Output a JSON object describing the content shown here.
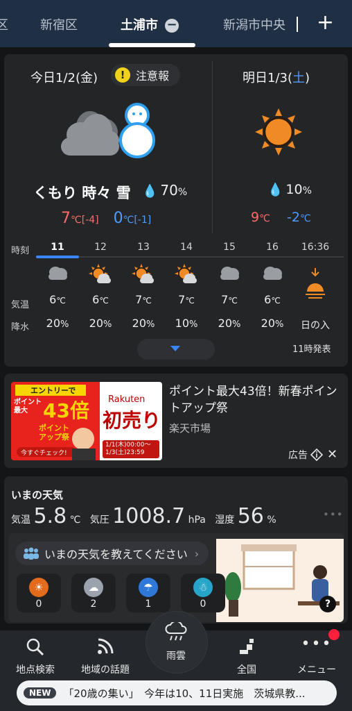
{
  "tabs": {
    "left_edge": "区",
    "items": [
      "新宿区",
      "土浦市",
      "新潟市中央"
    ],
    "active_index": 1,
    "add_label": "+"
  },
  "today": {
    "date_label": "今日1/2(金)",
    "warning_label": "注意報",
    "weather_text": "くもり 時々 雪",
    "pop": "70",
    "pop_unit": "%",
    "high": "7",
    "high_diff": "[-4]",
    "low": "0",
    "low_diff": "[-1]",
    "temp_unit": "℃"
  },
  "tomorrow": {
    "date_prefix": "明日1/3(",
    "date_day": "土",
    "date_suffix": ")",
    "pop": "10",
    "pop_unit": "%",
    "high": "9",
    "low": "-2",
    "temp_unit": "℃"
  },
  "hourly": {
    "labels": {
      "time": "時刻",
      "temp": "気温",
      "precip": "降水"
    },
    "hours": [
      {
        "time": "11",
        "icon": "cloud-icon",
        "temp": "6",
        "pop": "20"
      },
      {
        "time": "12",
        "icon": "sun-cloud-icon",
        "temp": "6",
        "pop": "20"
      },
      {
        "time": "13",
        "icon": "sun-cloud-icon",
        "temp": "7",
        "pop": "20"
      },
      {
        "time": "14",
        "icon": "sun-cloud-icon",
        "temp": "7",
        "pop": "10"
      },
      {
        "time": "15",
        "icon": "cloud-icon",
        "temp": "7",
        "pop": "20"
      },
      {
        "time": "16",
        "icon": "cloud-icon",
        "temp": "6",
        "pop": "20"
      }
    ],
    "sunset_time": "16:36",
    "sunset_label": "日の入",
    "temp_unit": "℃",
    "pop_unit": "%",
    "issued": "11時発表"
  },
  "ad": {
    "title": "ポイント最大43倍！新春ポイントアップ祭",
    "source": "楽天市場",
    "label": "広告",
    "image_text": {
      "entry": "エントリーで",
      "points": "ポイント最大",
      "multiplier": "43倍",
      "fest": "ポイントアップ祭",
      "check": "今すぐチェック!",
      "brand": "Rakuten",
      "sale": "初売り",
      "period": "1/1(木)00:00～1/3(土)23:59"
    }
  },
  "now": {
    "title": "いまの天気",
    "temp_label": "気温",
    "temp_value": "5.8",
    "temp_unit": "℃",
    "pressure_label": "気圧",
    "pressure_value": "1008.7",
    "pressure_unit": "hPa",
    "humidity_label": "湿度",
    "humidity_value": "56",
    "humidity_unit": "%",
    "ask_label": "いまの天気を教えてください",
    "votes": [
      {
        "icon": "sun-icon",
        "count": "0",
        "color": "#e46a1c"
      },
      {
        "icon": "cloud-icon",
        "count": "2",
        "color": "#9aa3ad"
      },
      {
        "icon": "umbrella-icon",
        "count": "1",
        "color": "#2f78d8"
      },
      {
        "icon": "snowman-icon",
        "count": "0",
        "color": "#25a6c9"
      }
    ],
    "help": "?"
  },
  "nav": {
    "search": "地点検索",
    "topics": "地域の話題",
    "rain": "雨雲",
    "national": "全国",
    "menu": "メニュー"
  },
  "news": {
    "badge": "NEW",
    "text": "「20歳の集い」　今年は10、11日実施　茨城県教..."
  },
  "colors": {
    "accent": "#3a86ff",
    "warning": "#f1d21b",
    "high_temp": "#ff6b6b",
    "low_temp": "#4f9cff",
    "sun": "#f08a24"
  }
}
